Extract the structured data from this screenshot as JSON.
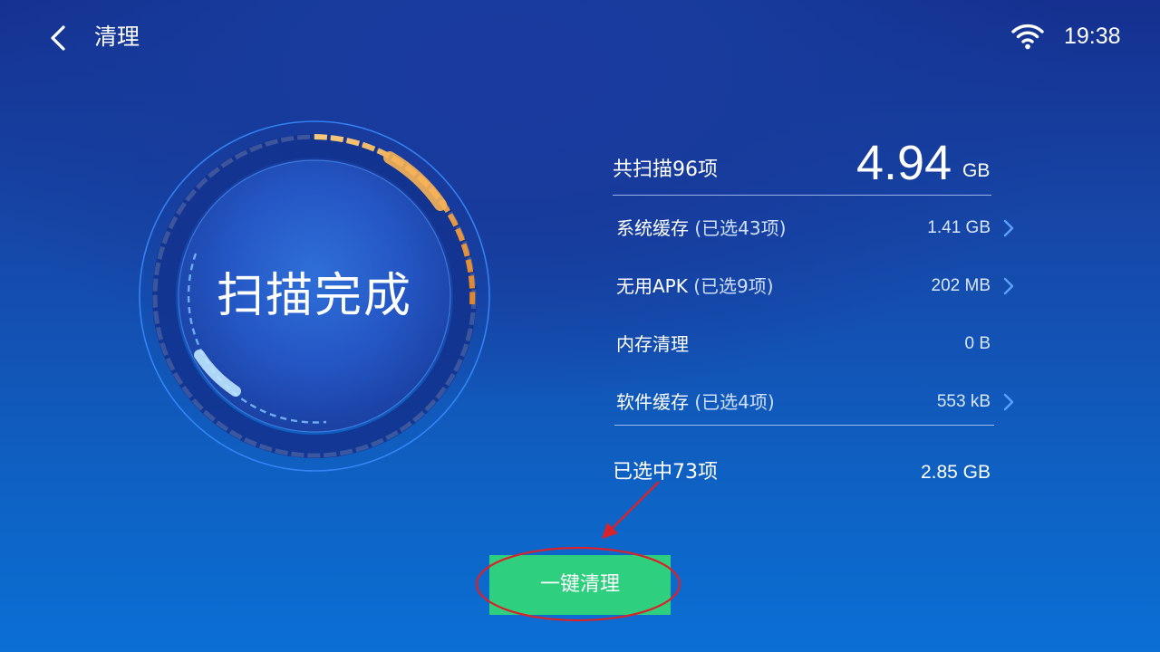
{
  "header": {
    "back_icon": "chevron-left-icon",
    "title": "清理",
    "wifi_icon": "wifi-icon",
    "time": "19:38"
  },
  "gauge": {
    "status_text": "扫描完成",
    "accent_color": "#f2a64a",
    "ring_color": "#3a8cff"
  },
  "summary": {
    "total_label": "共扫描96项",
    "total_value": "4.94",
    "total_unit": "GB",
    "categories": [
      {
        "name": "系统缓存",
        "selected": "(已选43项)",
        "size": "1.41 GB",
        "has_chevron": true
      },
      {
        "name": "无用APK",
        "selected": "(已选9项)",
        "size": "202 MB",
        "has_chevron": true
      },
      {
        "name": "内存清理",
        "selected": "",
        "size": "0 B",
        "has_chevron": false
      },
      {
        "name": "软件缓存",
        "selected": "(已选4项)",
        "size": "553 kB",
        "has_chevron": true
      }
    ],
    "selected_label": "已选中73项",
    "selected_value": "2.85 GB"
  },
  "actions": {
    "clean_label": "一键清理",
    "clean_color": "#2ecf7e",
    "annotation_color": "#d8232a"
  }
}
